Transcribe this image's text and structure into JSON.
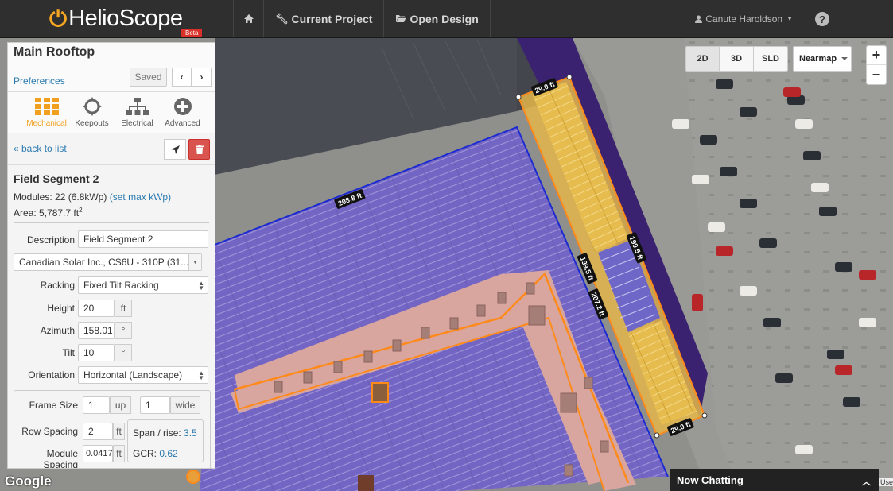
{
  "nav": {
    "brand": "HelioScope",
    "beta": "Beta",
    "home_icon": "home-icon",
    "current_project": "Current Project",
    "open_design": "Open Design",
    "user": "Canute Haroldson",
    "help": "?"
  },
  "map": {
    "view_buttons": [
      "2D",
      "3D",
      "SLD"
    ],
    "active_view": "2D",
    "layer": "Nearmap",
    "zoom_in": "+",
    "zoom_out": "−",
    "google": "Google",
    "chat": "Now Chatting",
    "terms": "Use",
    "dimensions": {
      "d1": "29.0 ft",
      "d2": "208.8 ft",
      "d3": "199.5 ft",
      "d4": "199.5 ft",
      "d5": "207.2 ft",
      "d6": "29.0 ft"
    },
    "colors": {
      "module": "#6d63c9",
      "roof": "#d9a7a2",
      "segment": "#e3b54a",
      "outline": "#ff8c1a"
    }
  },
  "panel": {
    "title": "Main Rooftop",
    "preferences": "Preferences",
    "saved": "Saved",
    "tabs": [
      {
        "label": "Mechanical",
        "icon": "grid-icon",
        "active": true
      },
      {
        "label": "Keepouts",
        "icon": "crosshair-icon",
        "active": false
      },
      {
        "label": "Electrical",
        "icon": "sitemap-icon",
        "active": false
      },
      {
        "label": "Advanced",
        "icon": "plus-circle-icon",
        "active": false
      }
    ],
    "back": "« back to list",
    "segment_title": "Field Segment 2",
    "modules_text": "Modules: 22 (6.8kWp)",
    "set_max": "(set max kWp)",
    "area_text": "Area: 5,787.7 ft",
    "area_sup": "2",
    "description_label": "Description",
    "description_value": "Field Segment 2",
    "module_select": "Canadian Solar Inc., CS6U - 310P (31...",
    "racking_label": "Racking",
    "racking_value": "Fixed Tilt Racking",
    "height_label": "Height",
    "height_value": "20",
    "height_unit": "ft",
    "azimuth_label": "Azimuth",
    "azimuth_value": "158.01",
    "azimuth_unit": "°",
    "tilt_label": "Tilt",
    "tilt_value": "10",
    "tilt_unit": "°",
    "orientation_label": "Orientation",
    "orientation_value": "Horizontal (Landscape)",
    "frame_label": "Frame Size",
    "frame_up_value": "1",
    "frame_up_unit": "up",
    "frame_wide_value": "1",
    "frame_wide_unit": "wide",
    "row_spacing_label": "Row Spacing",
    "row_spacing_value": "2",
    "row_spacing_unit": "ft",
    "module_spacing_label": "Module Spacing",
    "module_spacing_value": "0.0417",
    "module_spacing_unit": "ft",
    "span_label": "Span / rise:",
    "span_value": "3.5",
    "gcr_label": "GCR:",
    "gcr_value": "0.62"
  }
}
